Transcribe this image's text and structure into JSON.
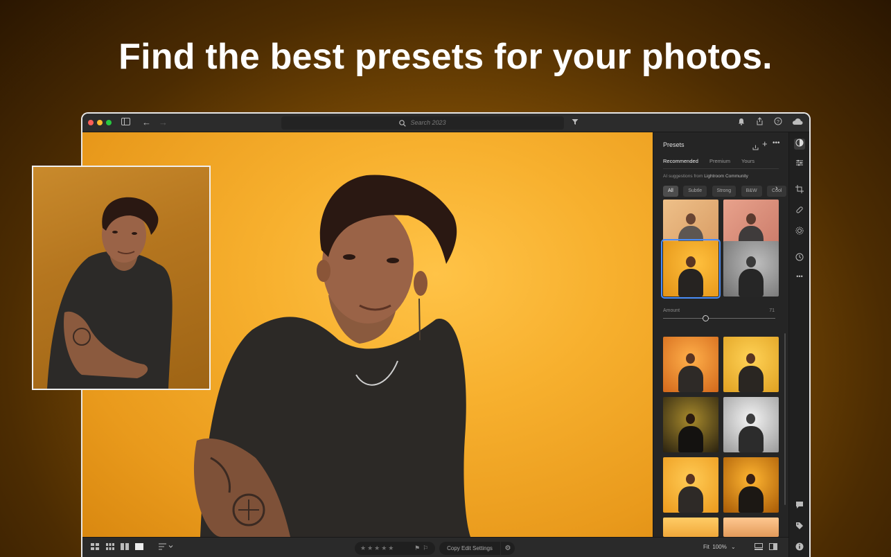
{
  "headline": "Find the best presets for your photos.",
  "window": {
    "traffic_lights": [
      "#ff5f57",
      "#febc2e",
      "#28c840"
    ],
    "search_placeholder": "Search 2023"
  },
  "panel": {
    "title": "Presets",
    "tabs": [
      {
        "label": "Recommended",
        "active": true
      },
      {
        "label": "Premium",
        "active": false
      },
      {
        "label": "Yours",
        "active": false
      }
    ],
    "ai_note_prefix": "AI suggestions from",
    "ai_note_source": "Lightroom Community",
    "chips": [
      {
        "label": "All",
        "active": true
      },
      {
        "label": "Subtle",
        "active": false
      },
      {
        "label": "Strong",
        "active": false
      },
      {
        "label": "B&W",
        "active": false
      },
      {
        "label": "Cool",
        "active": false
      }
    ],
    "amount_label": "Amount",
    "amount_value": "71",
    "amount_fraction": 0.38
  },
  "bottombar": {
    "copy_label": "Copy Edit Settings",
    "fit_label": "Fit",
    "zoom_value": "100%"
  },
  "colors": {
    "accent": "#4a8df8",
    "backdrop": "#f5ab2a"
  }
}
